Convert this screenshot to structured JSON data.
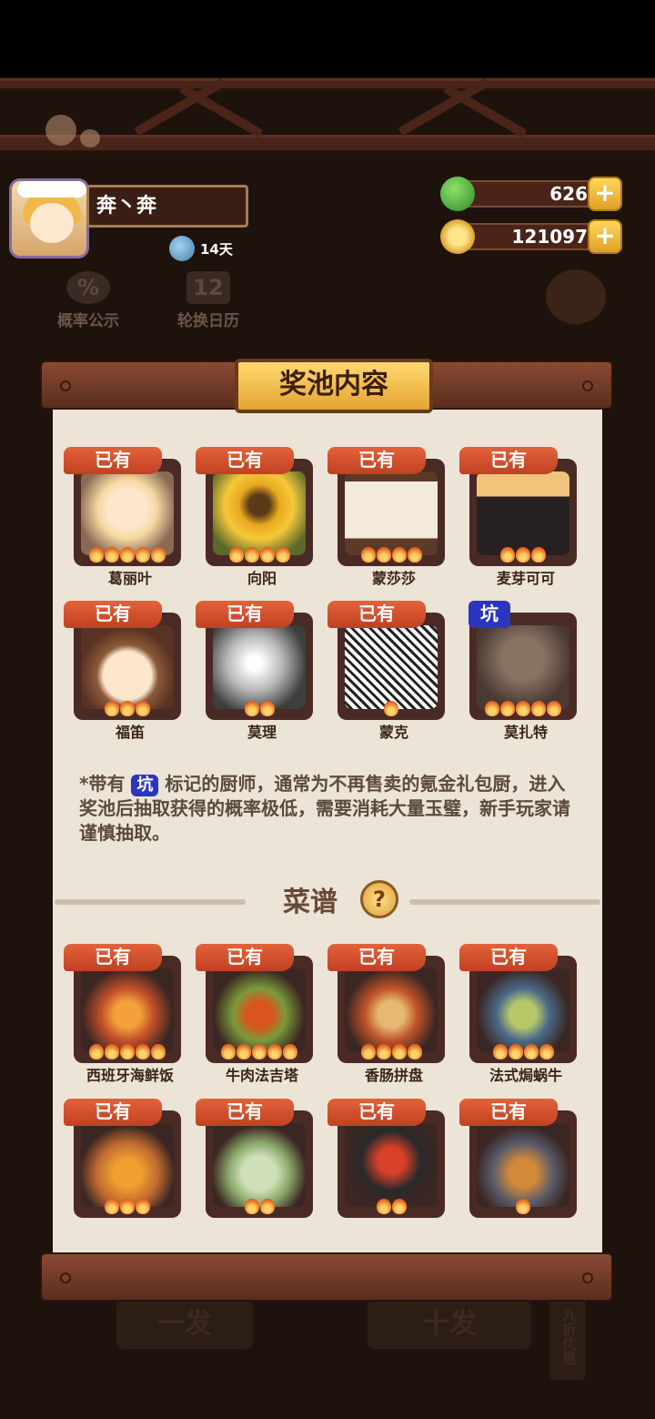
{
  "player": {
    "name": "奔丶奔",
    "days": "14天"
  },
  "currency": {
    "jade": "626",
    "coins": "121097"
  },
  "background_tools": {
    "probability": "概率公示",
    "rotation_calendar": "轮换日历",
    "draw_one": "一发",
    "draw_ten": "十发",
    "discount": "九折优惠"
  },
  "panel": {
    "title": "奖池内容",
    "chefs": [
      {
        "name": "葛丽叶",
        "tag": "已有",
        "stars": 5
      },
      {
        "name": "向阳",
        "tag": "已有",
        "stars": 4
      },
      {
        "name": "蒙莎莎",
        "tag": "已有",
        "stars": 4
      },
      {
        "name": "麦芽可可",
        "tag": "已有",
        "stars": 3
      },
      {
        "name": "福笛",
        "tag": "已有",
        "stars": 3
      },
      {
        "name": "莫理",
        "tag": "已有",
        "stars": 2
      },
      {
        "name": "蒙克",
        "tag": "已有",
        "stars": 1
      },
      {
        "name": "莫扎特",
        "tag": "坑",
        "stars": 5
      }
    ],
    "note_prefix": "*带有",
    "note_tag": "坑",
    "note_text": "标记的厨师，通常为不再售卖的氪金礼包厨，进入奖池后抽取获得的概率极低，需要消耗大量玉璧，新手玩家请谨慎抽取。",
    "recipe_title": "菜谱",
    "help_icon": "?",
    "recipes": [
      {
        "name": "西班牙海鲜饭",
        "tag": "已有",
        "stars": 5
      },
      {
        "name": "牛肉法吉塔",
        "tag": "已有",
        "stars": 5
      },
      {
        "name": "香肠拼盘",
        "tag": "已有",
        "stars": 4
      },
      {
        "name": "法式焗蜗牛",
        "tag": "已有",
        "stars": 4
      },
      {
        "name": "",
        "tag": "已有",
        "stars": 3
      },
      {
        "name": "",
        "tag": "已有",
        "stars": 2
      },
      {
        "name": "",
        "tag": "已有",
        "stars": 2
      },
      {
        "name": "",
        "tag": "已有",
        "stars": 1
      }
    ]
  },
  "colors": {
    "tag_owned": "#d0502c",
    "tag_pit": "#2a36c0",
    "paper": "#ece4d6",
    "rail": "#6e3826"
  }
}
